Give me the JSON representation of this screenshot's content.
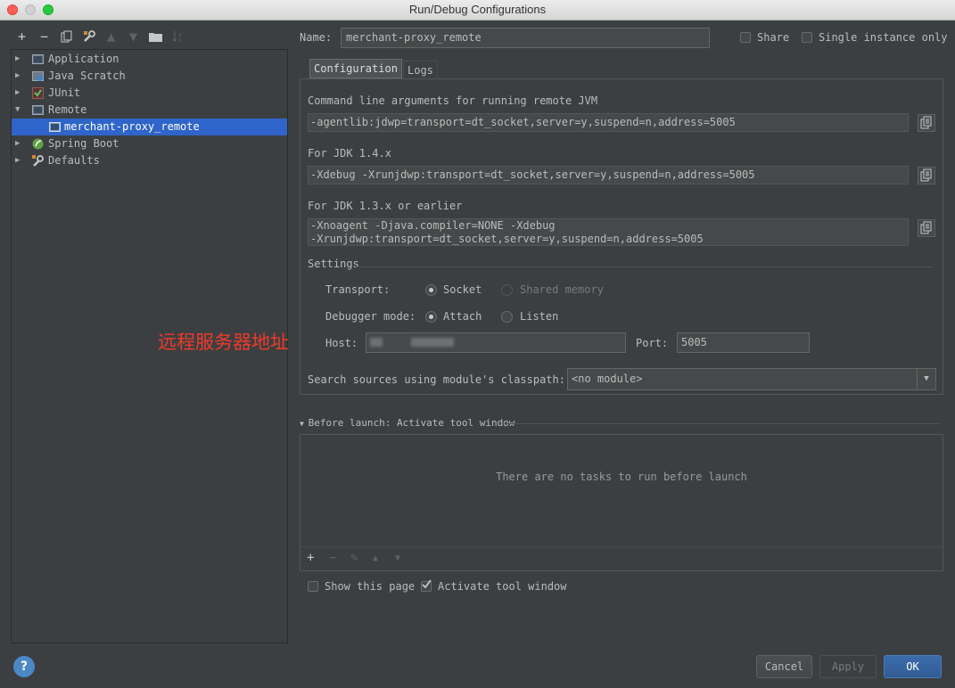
{
  "window": {
    "title": "Run/Debug Configurations"
  },
  "toolbar": {
    "buttons": [
      "add-icon",
      "remove-icon",
      "copy-icon",
      "wrench-icon",
      "move-up-icon",
      "move-down-icon",
      "folder-icon",
      "sort-icon"
    ]
  },
  "tree": {
    "items": [
      {
        "label": "Application",
        "expanded": false,
        "icon": "application-icon"
      },
      {
        "label": "Java Scratch",
        "expanded": false,
        "icon": "java-scratch-icon"
      },
      {
        "label": "JUnit",
        "expanded": false,
        "icon": "junit-icon"
      },
      {
        "label": "Remote",
        "expanded": true,
        "icon": "remote-icon"
      },
      {
        "label": "merchant-proxy_remote",
        "selected": true,
        "icon": "remote-config-icon"
      },
      {
        "label": "Spring Boot",
        "expanded": false,
        "icon": "spring-boot-icon"
      },
      {
        "label": "Defaults",
        "expanded": false,
        "icon": "defaults-icon"
      }
    ]
  },
  "config": {
    "name_label": "Name:",
    "name_value": "merchant-proxy_remote",
    "share_label": "Share",
    "single_instance_label": "Single instance only"
  },
  "tabs": {
    "configuration": "Configuration",
    "logs": "Logs"
  },
  "remote": {
    "cmd_label": "Command line arguments for running remote JVM",
    "cmd_value": "-agentlib:jdwp=transport=dt_socket,server=y,suspend=n,address=5005",
    "jdk14_label": "For JDK 1.4.x",
    "jdk14_value": "-Xdebug -Xrunjdwp:transport=dt_socket,server=y,suspend=n,address=5005",
    "jdk13_label": "For JDK 1.3.x or earlier",
    "jdk13_line1": "-Xnoagent -Djava.compiler=NONE -Xdebug",
    "jdk13_line2": "-Xrunjdwp:transport=dt_socket,server=y,suspend=n,address=5005"
  },
  "settings": {
    "title": "Settings",
    "transport_label": "Transport:",
    "socket_label": "Socket",
    "shared_memory_label": "Shared memory",
    "debugger_mode_label": "Debugger mode:",
    "attach_label": "Attach",
    "listen_label": "Listen",
    "host_label": "Host:",
    "port_label": "Port:",
    "port_value": "5005",
    "search_label": "Search sources using module's classpath:",
    "module_value": "<no module>"
  },
  "annotation": "远程服务器地址",
  "before_launch": {
    "title": "Before launch: Activate tool window",
    "empty_text": "There are no tasks to run before launch",
    "show_page_label": "Show this page",
    "activate_label": "Activate tool window"
  },
  "footer": {
    "help": "?",
    "cancel": "Cancel",
    "apply": "Apply",
    "ok": "OK"
  }
}
